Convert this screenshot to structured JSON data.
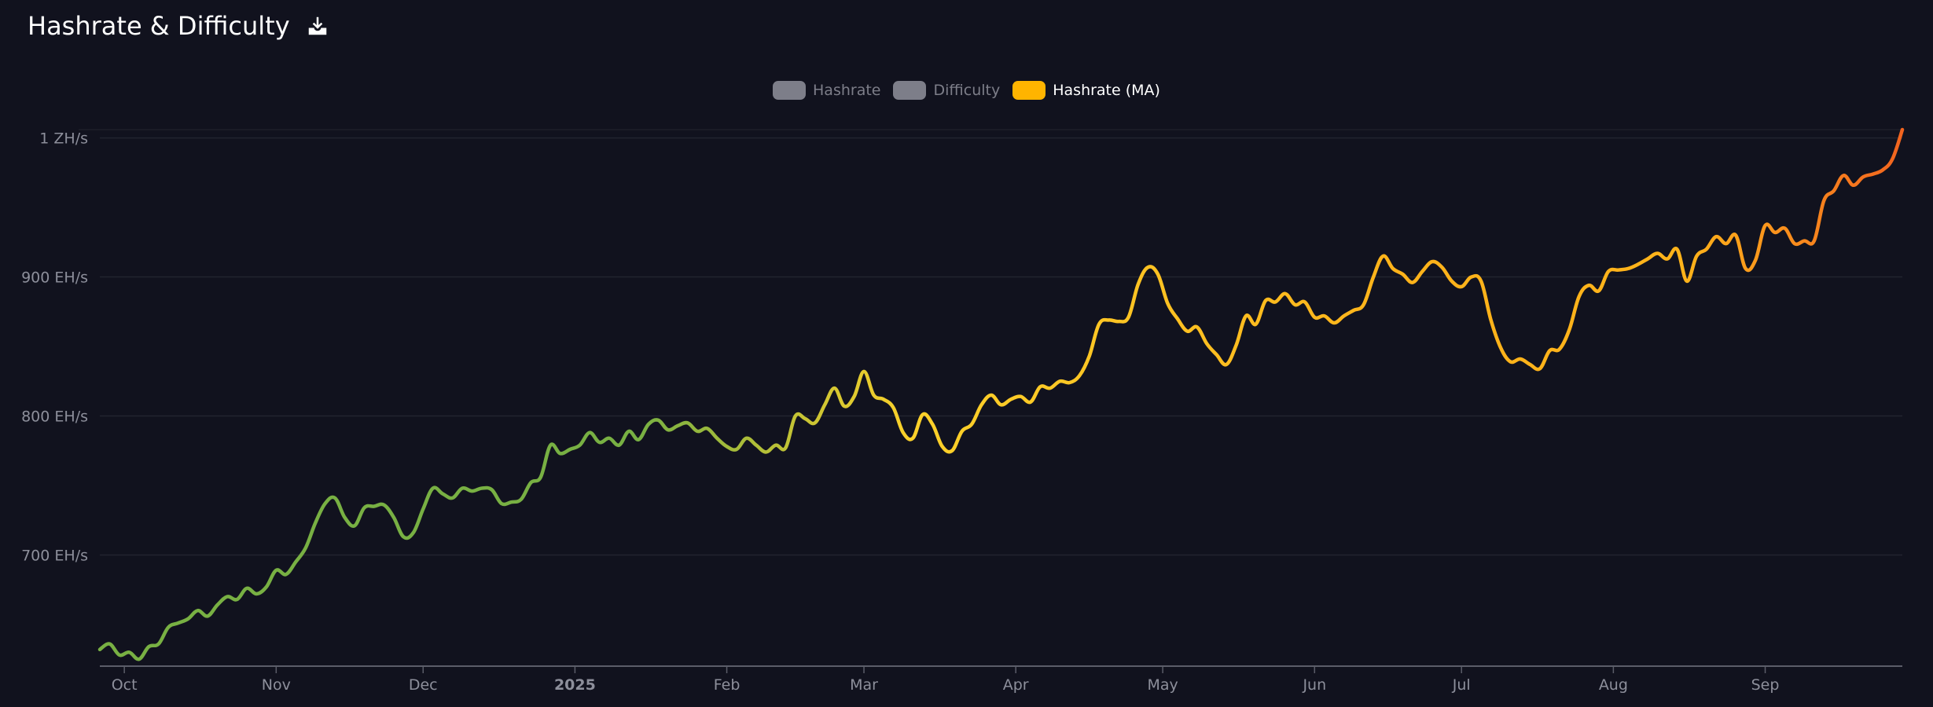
{
  "header": {
    "title": "Hashrate & Difficulty",
    "download_icon": "download-icon"
  },
  "legend": [
    {
      "label": "Hashrate",
      "active": false,
      "color": "#7d7e89"
    },
    {
      "label": "Difficulty",
      "active": false,
      "color": "#7d7e89"
    },
    {
      "label": "Hashrate (MA)",
      "active": true,
      "color": "#ffb400"
    }
  ],
  "colors": {
    "background": "#11121e",
    "grid": "#22242f",
    "axis": "#5b5d69",
    "line_start": "#78b043",
    "line_mid": "#fcd12a",
    "line_mid2": "#ffb31a",
    "line_end": "#f2641f"
  },
  "chart_data": {
    "type": "line",
    "title": "Hashrate & Difficulty",
    "series": [
      {
        "name": "Hashrate (MA)",
        "unit": "EH/s",
        "points": [
          [
            "2024-09-26",
            632
          ],
          [
            "2024-09-28",
            636
          ],
          [
            "2024-09-30",
            628
          ],
          [
            "2024-10-02",
            630
          ],
          [
            "2024-10-04",
            625
          ],
          [
            "2024-10-06",
            634
          ],
          [
            "2024-10-08",
            636
          ],
          [
            "2024-10-10",
            648
          ],
          [
            "2024-10-12",
            651
          ],
          [
            "2024-10-14",
            654
          ],
          [
            "2024-10-16",
            660
          ],
          [
            "2024-10-18",
            656
          ],
          [
            "2024-10-20",
            664
          ],
          [
            "2024-10-22",
            670
          ],
          [
            "2024-10-24",
            668
          ],
          [
            "2024-10-26",
            676
          ],
          [
            "2024-10-28",
            672
          ],
          [
            "2024-10-30",
            677
          ],
          [
            "2024-11-01",
            689
          ],
          [
            "2024-11-03",
            686
          ],
          [
            "2024-11-05",
            695
          ],
          [
            "2024-11-07",
            705
          ],
          [
            "2024-11-09",
            723
          ],
          [
            "2024-11-11",
            737
          ],
          [
            "2024-11-13",
            741
          ],
          [
            "2024-11-15",
            727
          ],
          [
            "2024-11-17",
            721
          ],
          [
            "2024-11-19",
            734
          ],
          [
            "2024-11-21",
            735
          ],
          [
            "2024-11-23",
            736
          ],
          [
            "2024-11-25",
            727
          ],
          [
            "2024-11-27",
            713
          ],
          [
            "2024-11-29",
            716
          ],
          [
            "2024-12-01",
            733
          ],
          [
            "2024-12-03",
            748
          ],
          [
            "2024-12-05",
            744
          ],
          [
            "2024-12-07",
            741
          ],
          [
            "2024-12-09",
            748
          ],
          [
            "2024-12-11",
            746
          ],
          [
            "2024-12-13",
            748
          ],
          [
            "2024-12-15",
            747
          ],
          [
            "2024-12-17",
            737
          ],
          [
            "2024-12-19",
            738
          ],
          [
            "2024-12-21",
            740
          ],
          [
            "2024-12-23",
            752
          ],
          [
            "2024-12-25",
            756
          ],
          [
            "2024-12-27",
            779
          ],
          [
            "2024-12-29",
            773
          ],
          [
            "2024-12-31",
            776
          ],
          [
            "2025-01-02",
            779
          ],
          [
            "2025-01-04",
            788
          ],
          [
            "2025-01-06",
            781
          ],
          [
            "2025-01-08",
            784
          ],
          [
            "2025-01-10",
            779
          ],
          [
            "2025-01-12",
            789
          ],
          [
            "2025-01-14",
            783
          ],
          [
            "2025-01-16",
            794
          ],
          [
            "2025-01-18",
            797
          ],
          [
            "2025-01-20",
            790
          ],
          [
            "2025-01-22",
            793
          ],
          [
            "2025-01-24",
            795
          ],
          [
            "2025-01-26",
            789
          ],
          [
            "2025-01-28",
            791
          ],
          [
            "2025-01-30",
            784
          ],
          [
            "2025-02-01",
            778
          ],
          [
            "2025-02-03",
            776
          ],
          [
            "2025-02-05",
            784
          ],
          [
            "2025-02-07",
            779
          ],
          [
            "2025-02-09",
            774
          ],
          [
            "2025-02-11",
            779
          ],
          [
            "2025-02-13",
            777
          ],
          [
            "2025-02-15",
            800
          ],
          [
            "2025-02-17",
            798
          ],
          [
            "2025-02-19",
            795
          ],
          [
            "2025-02-21",
            808
          ],
          [
            "2025-02-23",
            820
          ],
          [
            "2025-02-25",
            807
          ],
          [
            "2025-02-27",
            814
          ],
          [
            "2025-03-01",
            832
          ],
          [
            "2025-03-03",
            815
          ],
          [
            "2025-03-05",
            812
          ],
          [
            "2025-03-07",
            806
          ],
          [
            "2025-03-09",
            788
          ],
          [
            "2025-03-11",
            784
          ],
          [
            "2025-03-13",
            801
          ],
          [
            "2025-03-15",
            794
          ],
          [
            "2025-03-17",
            778
          ],
          [
            "2025-03-19",
            775
          ],
          [
            "2025-03-21",
            789
          ],
          [
            "2025-03-23",
            794
          ],
          [
            "2025-03-25",
            808
          ],
          [
            "2025-03-27",
            815
          ],
          [
            "2025-03-29",
            808
          ],
          [
            "2025-03-31",
            812
          ],
          [
            "2025-04-02",
            814
          ],
          [
            "2025-04-04",
            810
          ],
          [
            "2025-04-06",
            821
          ],
          [
            "2025-04-08",
            820
          ],
          [
            "2025-04-10",
            825
          ],
          [
            "2025-04-12",
            824
          ],
          [
            "2025-04-14",
            829
          ],
          [
            "2025-04-16",
            843
          ],
          [
            "2025-04-18",
            866
          ],
          [
            "2025-04-20",
            869
          ],
          [
            "2025-04-22",
            868
          ],
          [
            "2025-04-24",
            871
          ],
          [
            "2025-04-26",
            895
          ],
          [
            "2025-04-28",
            907
          ],
          [
            "2025-04-30",
            902
          ],
          [
            "2025-05-02",
            881
          ],
          [
            "2025-05-04",
            870
          ],
          [
            "2025-05-06",
            861
          ],
          [
            "2025-05-08",
            864
          ],
          [
            "2025-05-10",
            852
          ],
          [
            "2025-05-12",
            844
          ],
          [
            "2025-05-14",
            837
          ],
          [
            "2025-05-16",
            851
          ],
          [
            "2025-05-18",
            872
          ],
          [
            "2025-05-20",
            866
          ],
          [
            "2025-05-22",
            883
          ],
          [
            "2025-05-24",
            882
          ],
          [
            "2025-05-26",
            888
          ],
          [
            "2025-05-28",
            880
          ],
          [
            "2025-05-30",
            882
          ],
          [
            "2025-06-01",
            871
          ],
          [
            "2025-06-03",
            872
          ],
          [
            "2025-06-05",
            867
          ],
          [
            "2025-06-07",
            872
          ],
          [
            "2025-06-09",
            876
          ],
          [
            "2025-06-11",
            880
          ],
          [
            "2025-06-13",
            900
          ],
          [
            "2025-06-15",
            915
          ],
          [
            "2025-06-17",
            906
          ],
          [
            "2025-06-19",
            902
          ],
          [
            "2025-06-21",
            896
          ],
          [
            "2025-06-23",
            904
          ],
          [
            "2025-06-25",
            911
          ],
          [
            "2025-06-27",
            907
          ],
          [
            "2025-06-29",
            897
          ],
          [
            "2025-07-01",
            893
          ],
          [
            "2025-07-03",
            900
          ],
          [
            "2025-07-05",
            897
          ],
          [
            "2025-07-07",
            869
          ],
          [
            "2025-07-09",
            849
          ],
          [
            "2025-07-11",
            839
          ],
          [
            "2025-07-13",
            841
          ],
          [
            "2025-07-15",
            837
          ],
          [
            "2025-07-17",
            834
          ],
          [
            "2025-07-19",
            847
          ],
          [
            "2025-07-21",
            848
          ],
          [
            "2025-07-23",
            862
          ],
          [
            "2025-07-25",
            886
          ],
          [
            "2025-07-27",
            894
          ],
          [
            "2025-07-29",
            890
          ],
          [
            "2025-07-31",
            904
          ],
          [
            "2025-08-02",
            905
          ],
          [
            "2025-08-04",
            906
          ],
          [
            "2025-08-06",
            909
          ],
          [
            "2025-08-08",
            913
          ],
          [
            "2025-08-10",
            917
          ],
          [
            "2025-08-12",
            913
          ],
          [
            "2025-08-14",
            920
          ],
          [
            "2025-08-16",
            897
          ],
          [
            "2025-08-18",
            915
          ],
          [
            "2025-08-20",
            920
          ],
          [
            "2025-08-22",
            929
          ],
          [
            "2025-08-24",
            924
          ],
          [
            "2025-08-26",
            930
          ],
          [
            "2025-08-28",
            906
          ],
          [
            "2025-08-30",
            912
          ],
          [
            "2025-09-01",
            937
          ],
          [
            "2025-09-03",
            932
          ],
          [
            "2025-09-05",
            935
          ],
          [
            "2025-09-07",
            924
          ],
          [
            "2025-09-09",
            926
          ],
          [
            "2025-09-11",
            926
          ],
          [
            "2025-09-13",
            955
          ],
          [
            "2025-09-15",
            962
          ],
          [
            "2025-09-17",
            973
          ],
          [
            "2025-09-19",
            966
          ],
          [
            "2025-09-21",
            972
          ],
          [
            "2025-09-23",
            974
          ],
          [
            "2025-09-25",
            977
          ],
          [
            "2025-09-27",
            985
          ],
          [
            "2025-09-29",
            1006
          ]
        ]
      }
    ],
    "y_ticks": [
      {
        "value": 700,
        "label": "700 EH/s"
      },
      {
        "value": 800,
        "label": "800 EH/s"
      },
      {
        "value": 900,
        "label": "900 EH/s"
      },
      {
        "value": 1000,
        "label": "1 ZH/s"
      }
    ],
    "x_ticks": [
      {
        "date": "2024-10-01",
        "label": "Oct",
        "bold": false
      },
      {
        "date": "2024-11-01",
        "label": "Nov",
        "bold": false
      },
      {
        "date": "2024-12-01",
        "label": "Dec",
        "bold": false
      },
      {
        "date": "2025-01-01",
        "label": "2025",
        "bold": true
      },
      {
        "date": "2025-02-01",
        "label": "Feb",
        "bold": false
      },
      {
        "date": "2025-03-01",
        "label": "Mar",
        "bold": false
      },
      {
        "date": "2025-04-01",
        "label": "Apr",
        "bold": false
      },
      {
        "date": "2025-05-01",
        "label": "May",
        "bold": false
      },
      {
        "date": "2025-06-01",
        "label": "Jun",
        "bold": false
      },
      {
        "date": "2025-07-01",
        "label": "Jul",
        "bold": false
      },
      {
        "date": "2025-08-01",
        "label": "Aug",
        "bold": false
      },
      {
        "date": "2025-09-01",
        "label": "Sep",
        "bold": false
      }
    ],
    "ylim": [
      620,
      1006
    ],
    "xlim": [
      "2024-09-26",
      "2025-09-29"
    ],
    "grid": true,
    "legend_position": "top-center"
  }
}
